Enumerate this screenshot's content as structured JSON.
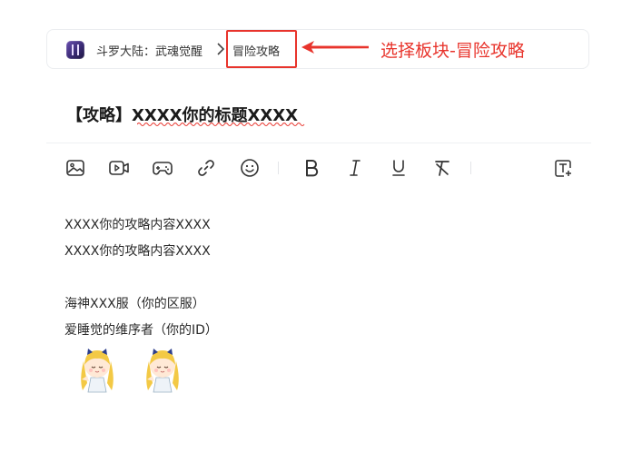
{
  "breadcrumb": {
    "game": "斗罗大陆：武魂觉醒",
    "board": "冒险攻略"
  },
  "annotation": {
    "text": "选择板块-冒险攻略",
    "color": "#e8342c"
  },
  "post": {
    "title": "【攻略】XXXX你的标题XXXX",
    "lines": [
      "XXXX你的攻略内容XXXX",
      "XXXX你的攻略内容XXXX",
      "",
      "海神XXX服（你的区服）",
      "爱睡觉的维序者（你的ID）"
    ]
  },
  "toolbar": {
    "tools": [
      "image-icon",
      "video-icon",
      "gamepad-icon",
      "link-icon",
      "emoji-icon",
      "bold-icon",
      "italic-icon",
      "underline-icon",
      "clear-format-icon",
      "text-template-icon"
    ]
  },
  "stickers": [
    "chibi-sticker",
    "chibi-sticker"
  ]
}
